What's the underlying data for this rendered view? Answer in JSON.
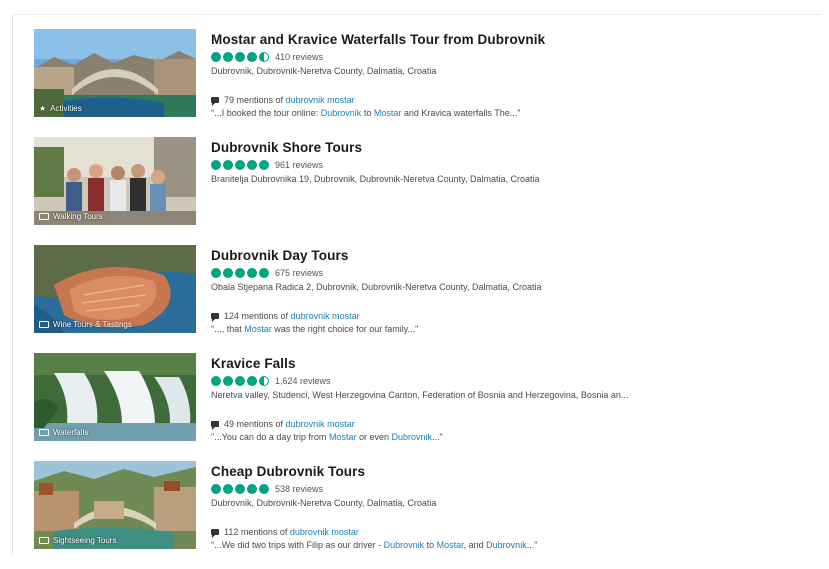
{
  "results": [
    {
      "title": "Mostar and Kravice Waterfalls Tour from Dubrovnik",
      "rating": 4.5,
      "reviews": "410 reviews",
      "address": "Dubrovnik, Dubrovnik-Neretva County, Dalmatia, Croatia",
      "category": "Activities",
      "mentions_prefix": "79 mentions of",
      "mentions_link": "dubrovnik mostar",
      "snippet": [
        "\"...I booked the tour online: ",
        "Dubrovnik",
        " to ",
        "Mostar",
        " and Kravica waterfalls The...\""
      ]
    },
    {
      "title": "Dubrovnik Shore Tours",
      "rating": 5,
      "reviews": "961 reviews",
      "address": "Branitelja Dubrovnika 19, Dubrovnik, Dubrovnik-Neretva County, Dalmatia, Croatia",
      "category": "Walking Tours"
    },
    {
      "title": "Dubrovnik Day Tours",
      "rating": 5,
      "reviews": "675 reviews",
      "address": "Obala Stjepana Radica 2, Dubrovnik, Dubrovnik-Neretva County, Dalmatia, Croatia",
      "category": "Wine Tours & Tastings",
      "mentions_prefix": "124 mentions of",
      "mentions_link": "dubrovnik mostar",
      "snippet": [
        "\"..., that ",
        "Mostar",
        " was the right choice for our family...\""
      ]
    },
    {
      "title": "Kravice Falls",
      "rating": 4.5,
      "reviews": "1,624 reviews",
      "address": "Neretva valley, Studenci, West Herzegovina Canton, Federation of Bosnia and Herzegovina, Bosnia an...",
      "category": "Waterfalls",
      "mentions_prefix": "49 mentions of",
      "mentions_link": "dubrovnik mostar",
      "snippet": [
        "\"...You can do a day trip from ",
        "Mostar",
        " or even ",
        "Dubrovnik",
        "...\""
      ]
    },
    {
      "title": "Cheap Dubrovnik Tours",
      "rating": 5,
      "reviews": "538 reviews",
      "address": "Dubrovnik, Dubrovnik-Neretva County, Dalmatia, Croatia",
      "category": "Sightseeing Tours",
      "mentions_prefix": "112 mentions of",
      "mentions_link": "dubrovnik mostar",
      "snippet": [
        "\"...We did two trips with Filip as our driver - ",
        "Dubrovnik",
        " to ",
        "Mostar",
        ", and ",
        "Dubrovnik",
        "...\""
      ]
    }
  ],
  "colors": {
    "bubble": "#00a680",
    "link": "#1a7fb5"
  }
}
